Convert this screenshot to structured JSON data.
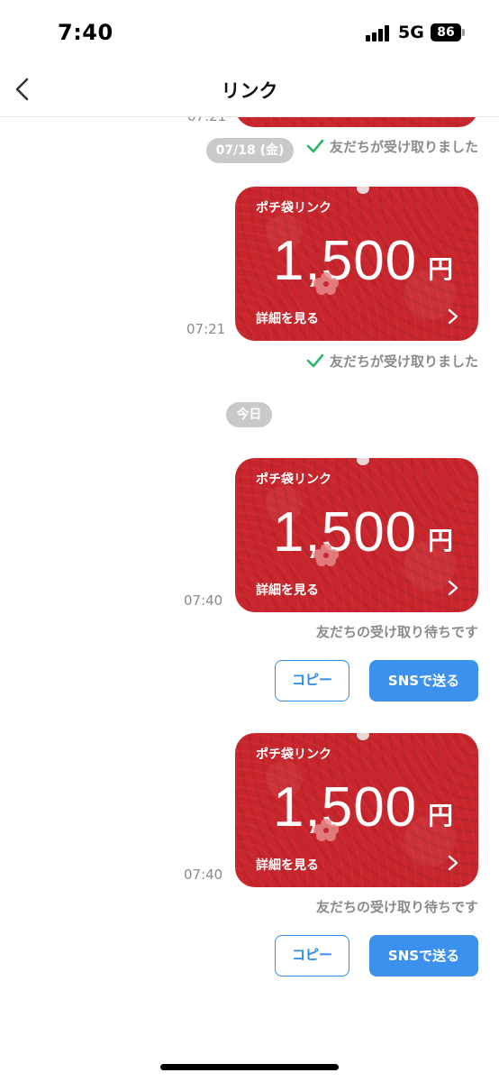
{
  "status_bar": {
    "time": "7:40",
    "network": "5G",
    "battery": "86"
  },
  "nav": {
    "title": "リンク",
    "back_icon": "chevron-left-icon"
  },
  "partial_top": {
    "time_text": "07:21"
  },
  "date_separators": [
    "07/18 (金)",
    "今日"
  ],
  "receipt_status": "友だちが受け取りました",
  "waiting_status": "友だちの受け取り待ちです",
  "card": {
    "title": "ポチ袋リンク",
    "amount": "1,500",
    "currency": "円",
    "details_label": "詳細を見る",
    "bg_color": "#c8262c"
  },
  "messages": [
    {
      "time": "07:21",
      "status": "友だちが受け取りました"
    },
    {
      "time": "07:40",
      "status": "友だちの受け取り待ちです"
    },
    {
      "time": "07:40",
      "status": "友だちの受け取り待ちです"
    }
  ],
  "buttons": {
    "copy": "コピー",
    "sns": "SNSで送る"
  },
  "colors": {
    "accent": "#3d91ee",
    "check": "#2db46a",
    "card": "#c8262c"
  }
}
